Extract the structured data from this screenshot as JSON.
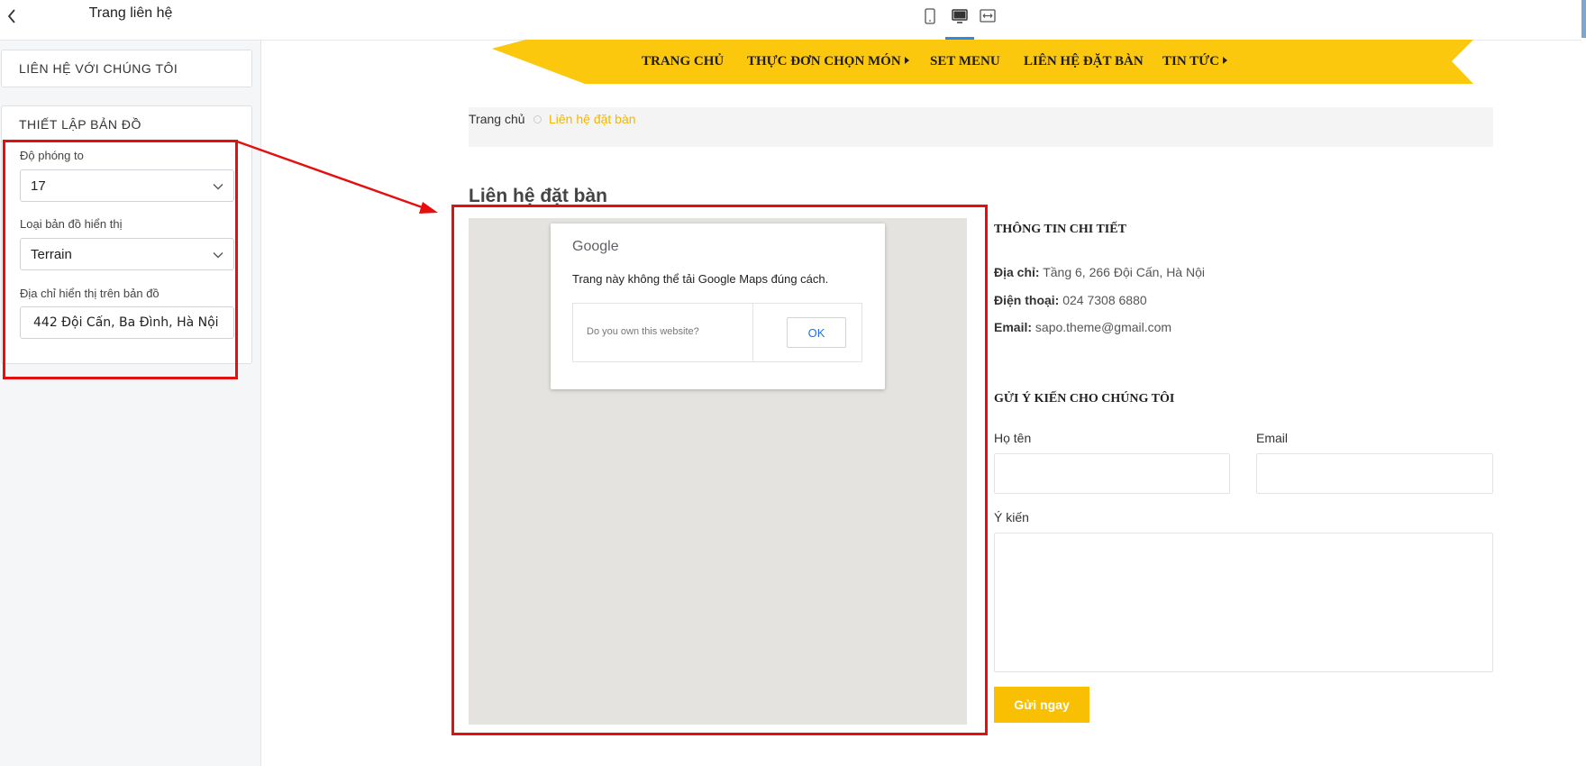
{
  "sidebar": {
    "title": "Trang liên hệ",
    "contact_section": "LIÊN HỆ VỚI CHÚNG TÔI",
    "map_section": {
      "title": "THIẾT LẬP BẢN ĐỒ",
      "zoom_label": "Độ phóng to",
      "zoom_value": "17",
      "map_type_label": "Loại bản đồ hiển thị",
      "map_type_value": "Terrain",
      "address_label": "Địa chỉ hiển thị trên bản đồ",
      "address_value": "442 Đội Cấn, Ba Đình, Hà Nội"
    }
  },
  "toolbar": {
    "devices": [
      "mobile-icon",
      "desktop-icon",
      "fullwidth-icon"
    ],
    "active_device": "desktop"
  },
  "nav": {
    "items": [
      {
        "label": "TRANG CHỦ",
        "has_dropdown": false
      },
      {
        "label": "THỰC ĐƠN CHỌN MÓN",
        "has_dropdown": true
      },
      {
        "label": "SET MENU",
        "has_dropdown": false
      },
      {
        "label": "LIÊN HỆ ĐẶT BÀN",
        "has_dropdown": false
      },
      {
        "label": "TIN TỨC",
        "has_dropdown": true
      }
    ],
    "color": "#fcc80d"
  },
  "breadcrumb": {
    "home": "Trang chủ",
    "current": "Liên hệ đặt bàn"
  },
  "page": {
    "heading": "Liên hệ đặt bàn"
  },
  "map": {
    "logo": "Google",
    "message": "Trang này không thể tải Google Maps đúng cách.",
    "own_question": "Do you own this website?",
    "ok_label": "OK"
  },
  "details": {
    "heading": "THÔNG TIN CHI TIẾT",
    "address_label": "Địa chỉ:",
    "address": "Tầng 6, 266 Đội Cấn, Hà Nội",
    "phone_label": "Điện thoại:",
    "phone": "024 7308 6880",
    "email_label": "Email:",
    "email": "sapo.theme@gmail.com"
  },
  "feedback": {
    "heading": "GỬI Ý KIẾN CHO CHÚNG TÔI",
    "name_label": "Họ tên",
    "email_label": "Email",
    "message_label": "Ý kiến",
    "submit_label": "Gửi ngay"
  },
  "colors": {
    "accent": "#f9bf02",
    "annotation": "#e40f0f",
    "active_tab": "#2b8ae6"
  }
}
